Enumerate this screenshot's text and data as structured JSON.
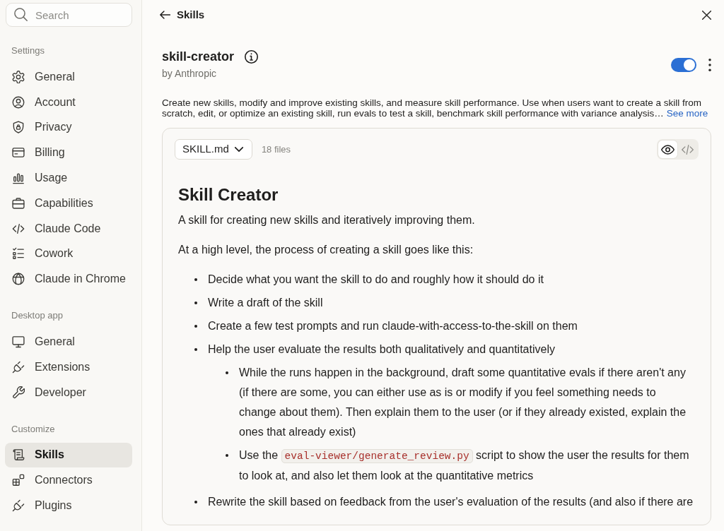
{
  "sidebar": {
    "search": {
      "placeholder": "Search"
    },
    "sections": [
      {
        "label": "Settings",
        "items": [
          {
            "label": "General",
            "selected": false
          },
          {
            "label": "Account",
            "selected": false
          },
          {
            "label": "Privacy",
            "selected": false
          },
          {
            "label": "Billing",
            "selected": false
          },
          {
            "label": "Usage",
            "selected": false
          },
          {
            "label": "Capabilities",
            "selected": false
          },
          {
            "label": "Claude Code",
            "selected": false
          },
          {
            "label": "Cowork",
            "selected": false
          },
          {
            "label": "Claude in Chrome",
            "selected": false
          }
        ]
      },
      {
        "label": "Desktop app",
        "items": [
          {
            "label": "General",
            "selected": false
          },
          {
            "label": "Extensions",
            "selected": false
          },
          {
            "label": "Developer",
            "selected": false
          }
        ]
      },
      {
        "label": "Customize",
        "items": [
          {
            "label": "Skills",
            "selected": true
          },
          {
            "label": "Connectors",
            "selected": false
          },
          {
            "label": "Plugins",
            "selected": false
          }
        ]
      }
    ]
  },
  "header": {
    "back_label": "Skills"
  },
  "skill": {
    "name": "skill-creator",
    "author": "by Anthropic",
    "enabled": true,
    "description": "Create new skills, modify and improve existing skills, and measure skill performance. Use when users want to create a skill from scratch, edit, or optimize an existing skill, run evals to test a skill, benchmark skill performance with variance analysis…",
    "see_more": "See more"
  },
  "file_viewer": {
    "file": "SKILL.md",
    "file_count": "18 files",
    "view_modes": [
      {
        "kind": "preview",
        "selected": true
      },
      {
        "kind": "code",
        "selected": false
      }
    ],
    "document": [
      {
        "kind": "heading",
        "text": "Skill Creator"
      },
      {
        "kind": "paragraph",
        "text": "A skill for creating new skills and iteratively improving them."
      },
      {
        "kind": "paragraph",
        "text": "At a high level, the process of creating a skill goes like this:"
      },
      {
        "kind": "list",
        "items": [
          {
            "text": "Decide what you want the skill to do and roughly how it should do it"
          },
          {
            "text": "Write a draft of the skill"
          },
          {
            "text": "Create a few test prompts and run claude-with-access-to-the-skill on them"
          },
          {
            "text": "Help the user evaluate the results both qualitatively and quantitatively",
            "children": [
              {
                "text": "While the runs happen in the background, draft some quantitative evals if there aren't any (if there are some, you can either use as is or modify if you feel something needs to change about them). Then explain them to the user (or if they already existed, explain the ones that already exist)"
              },
              {
                "parts": [
                  {
                    "kind": "text",
                    "text": "Use the "
                  },
                  {
                    "kind": "code",
                    "text": "eval-viewer/generate_review.py"
                  },
                  {
                    "kind": "text",
                    "text": " script to show the user the results for them to look at, and also let them look at the quantitative metrics"
                  }
                ]
              }
            ]
          },
          {
            "text": "Rewrite the skill based on feedback from the user's evaluation of the results (and also if there are"
          }
        ]
      }
    ]
  }
}
